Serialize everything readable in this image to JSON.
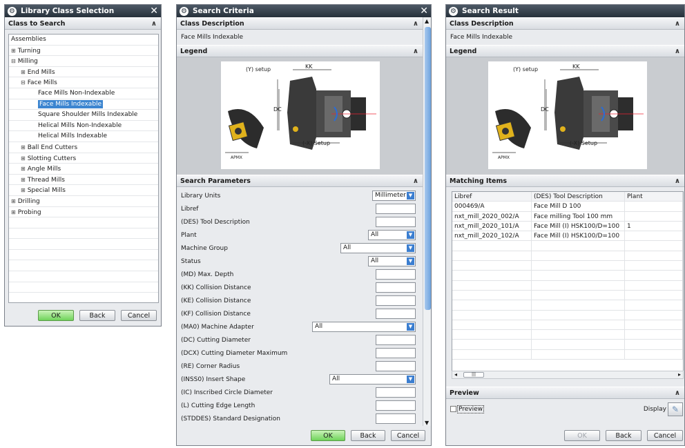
{
  "dialog1": {
    "title": "Library Class Selection",
    "section": "Class to Search",
    "tree": [
      {
        "label": "Assemblies",
        "indent": 0,
        "pm": ""
      },
      {
        "label": "Turning",
        "indent": 0,
        "pm": "⊞"
      },
      {
        "label": "Milling",
        "indent": 0,
        "pm": "⊟"
      },
      {
        "label": "End Mills",
        "indent": 1,
        "pm": "⊞"
      },
      {
        "label": "Face Mills",
        "indent": 1,
        "pm": "⊟"
      },
      {
        "label": "Face Mills Non-Indexable",
        "indent": 2,
        "pm": ""
      },
      {
        "label": "Face Mills Indexable",
        "indent": 2,
        "pm": "",
        "selected": true
      },
      {
        "label": "Square Shoulder Mills Indexable",
        "indent": 2,
        "pm": ""
      },
      {
        "label": "Helical Mills Non-Indexable",
        "indent": 2,
        "pm": ""
      },
      {
        "label": "Helical Mills Indexable",
        "indent": 2,
        "pm": ""
      },
      {
        "label": "Ball End Cutters",
        "indent": 1,
        "pm": "⊞"
      },
      {
        "label": "Slotting Cutters",
        "indent": 1,
        "pm": "⊞"
      },
      {
        "label": "Angle Mills",
        "indent": 1,
        "pm": "⊞"
      },
      {
        "label": "Thread Mills",
        "indent": 1,
        "pm": "⊞"
      },
      {
        "label": "Special Mills",
        "indent": 1,
        "pm": "⊞"
      },
      {
        "label": "Drilling",
        "indent": 0,
        "pm": "⊞"
      },
      {
        "label": "Probing",
        "indent": 0,
        "pm": "⊞"
      }
    ],
    "ok": "OK",
    "back": "Back",
    "cancel": "Cancel"
  },
  "dialog2": {
    "title": "Search Criteria",
    "class_section": "Class Description",
    "class_value": "Face Mills Indexable",
    "legend_section": "Legend",
    "params_section": "Search Parameters",
    "params": [
      {
        "label": "Library Units",
        "kind": "dd",
        "value": "Millimeter"
      },
      {
        "label": "Libref",
        "kind": "field",
        "value": ""
      },
      {
        "label": "(DES) Tool Description",
        "kind": "field",
        "value": ""
      },
      {
        "label": "Plant",
        "kind": "dd",
        "value": "All"
      },
      {
        "label": "Machine Group",
        "kind": "dd",
        "value": "All"
      },
      {
        "label": "Status",
        "kind": "dd",
        "value": "All"
      },
      {
        "label": "(MD) Max. Depth",
        "kind": "field",
        "value": ""
      },
      {
        "label": "(KK) Collision Distance",
        "kind": "field",
        "value": ""
      },
      {
        "label": "(KE) Collision Distance",
        "kind": "field",
        "value": ""
      },
      {
        "label": "(KF) Collision Distance",
        "kind": "field",
        "value": ""
      },
      {
        "label": "(MA0) Machine Adapter",
        "kind": "dd",
        "value": "All"
      },
      {
        "label": "(DC) Cutting Diameter",
        "kind": "field",
        "value": ""
      },
      {
        "label": "(DCX) Cutting Diameter Maximum",
        "kind": "field",
        "value": ""
      },
      {
        "label": "(RE) Corner Radius",
        "kind": "field",
        "value": ""
      },
      {
        "label": "(INSS0) Insert Shape",
        "kind": "dd",
        "value": "All"
      },
      {
        "label": "(IC) Inscribed Circle Diameter",
        "kind": "field",
        "value": ""
      },
      {
        "label": "(L) Cutting Edge Length",
        "kind": "field",
        "value": ""
      },
      {
        "label": "(STDDES) Standard Designation",
        "kind": "field",
        "value": ""
      }
    ],
    "ok": "OK",
    "back": "Back",
    "cancel": "Cancel"
  },
  "dialog3": {
    "title": "Search Result",
    "class_section": "Class Description",
    "class_value": "Face Mills Indexable",
    "legend_section": "Legend",
    "matching_section": "Matching Items",
    "columns": [
      "Libref",
      "(DES) Tool Description",
      "Plant"
    ],
    "rows": [
      [
        "000469/A",
        "Face Mill D 100",
        ""
      ],
      [
        "nxt_mill_2020_002/A",
        "Face milling Tool 100 mm",
        ""
      ],
      [
        "nxt_mill_2020_101/A",
        "Face Mill (I) HSK100/D=100",
        "1"
      ],
      [
        "nxt_mill_2020_102/A",
        "Face Mill (I) HSK100/D=100",
        ""
      ]
    ],
    "preview_section": "Preview",
    "preview_checkbox": "Preview",
    "display_label": "Display",
    "ok": "OK",
    "back": "Back",
    "cancel": "Cancel"
  },
  "legend_labels": {
    "y_setup": "(Y) setup",
    "kk": "KK",
    "dc": "DC",
    "x_setup": "(-X) Setup",
    "apmx": "APMX"
  }
}
